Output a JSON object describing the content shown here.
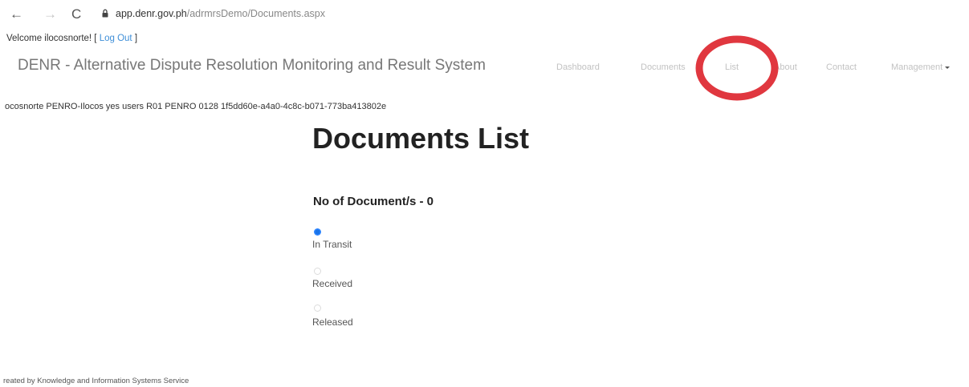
{
  "browser": {
    "back_icon": "←",
    "forward_icon": "→",
    "reload_icon": "C",
    "url_host": "app.denr.gov.ph",
    "url_path": "/adrmrsDemo/Documents.aspx"
  },
  "header": {
    "welcome_prefix": "Velcome ilocosnorte! [ ",
    "logout_label": "Log Out",
    "welcome_suffix": " ]",
    "brand": "DENR - Alternative Dispute Resolution Monitoring and Result System"
  },
  "navbar": {
    "dashboard": "Dashboard",
    "documents": "Documents",
    "list": "List",
    "about": "About",
    "contact": "Contact",
    "management": "Management"
  },
  "info_line": "ocosnorte PENRO-Ilocos yes users R01 PENRO 0128 1f5dd60e-a4a0-4c8c-b071-773ba413802e",
  "main": {
    "title": "Documents List",
    "count_label": "No of Document/s - 0",
    "filters": [
      {
        "label": "In Transit",
        "selected": true
      },
      {
        "label": "Received",
        "selected": false
      },
      {
        "label": "Released",
        "selected": false
      }
    ]
  },
  "footer": "reated by Knowledge and Information Systems Service",
  "colors": {
    "link": "#3f8fd8",
    "radio_selected": "#1a73e8",
    "annotation_circle": "#e0373f"
  }
}
